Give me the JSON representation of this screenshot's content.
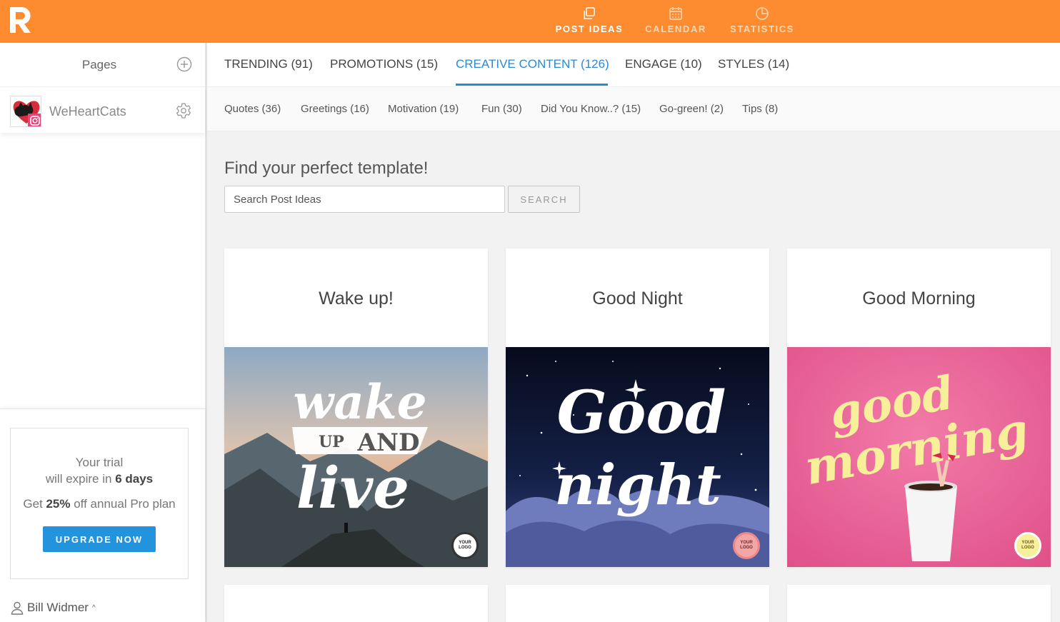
{
  "topnav": {
    "items": [
      {
        "label": "POST IDEAS",
        "icon": "copy-icon"
      },
      {
        "label": "CALENDAR",
        "icon": "calendar-icon"
      },
      {
        "label": "STATISTICS",
        "icon": "pie-chart-icon"
      }
    ]
  },
  "sidebar": {
    "pages_title": "Pages",
    "page": {
      "name": "WeHeartCats"
    },
    "trial": {
      "line1": "Your trial",
      "line2_prefix": "will expire in ",
      "line2_bold": "6 days",
      "line3_prefix": "Get ",
      "line3_bold": "25%",
      "line3_suffix": " off annual Pro plan",
      "button": "UPGRADE NOW"
    },
    "user": {
      "name": "Bill Widmer",
      "caret": "^"
    }
  },
  "categories": [
    {
      "label": "TRENDING (91)"
    },
    {
      "label": "PROMOTIONS (15)"
    },
    {
      "label": "CREATIVE CONTENT (126)"
    },
    {
      "label": "ENGAGE (10)"
    },
    {
      "label": "STYLES (14)"
    }
  ],
  "subcategories": [
    {
      "label": "Quotes (36)"
    },
    {
      "label": "Greetings (16)"
    },
    {
      "label": "Motivation (19)"
    },
    {
      "label": "Fun (30)"
    },
    {
      "label": "Did You Know..? (15)"
    },
    {
      "label": "Go-green! (2)"
    },
    {
      "label": "Tips (8)"
    }
  ],
  "search": {
    "title": "Find your perfect template!",
    "placeholder": "Search Post Ideas",
    "button": "SEARCH"
  },
  "cards": [
    {
      "title": "Wake up!",
      "img_words": [
        "wake",
        "UP",
        "AND",
        "live"
      ],
      "badge": [
        "YOUR",
        "LOGO"
      ]
    },
    {
      "title": "Good Night",
      "img_words": [
        "Good",
        "night"
      ],
      "badge": [
        "YOUR",
        "LOGO"
      ]
    },
    {
      "title": "Good Morning",
      "img_words": [
        "good",
        "morning"
      ],
      "badge": [
        "YOUR",
        "LOGO"
      ]
    }
  ],
  "colors": {
    "brand_orange": "#fd8c31",
    "accent_blue": "#2a8ad0",
    "upgrade_blue": "#2393dd"
  }
}
